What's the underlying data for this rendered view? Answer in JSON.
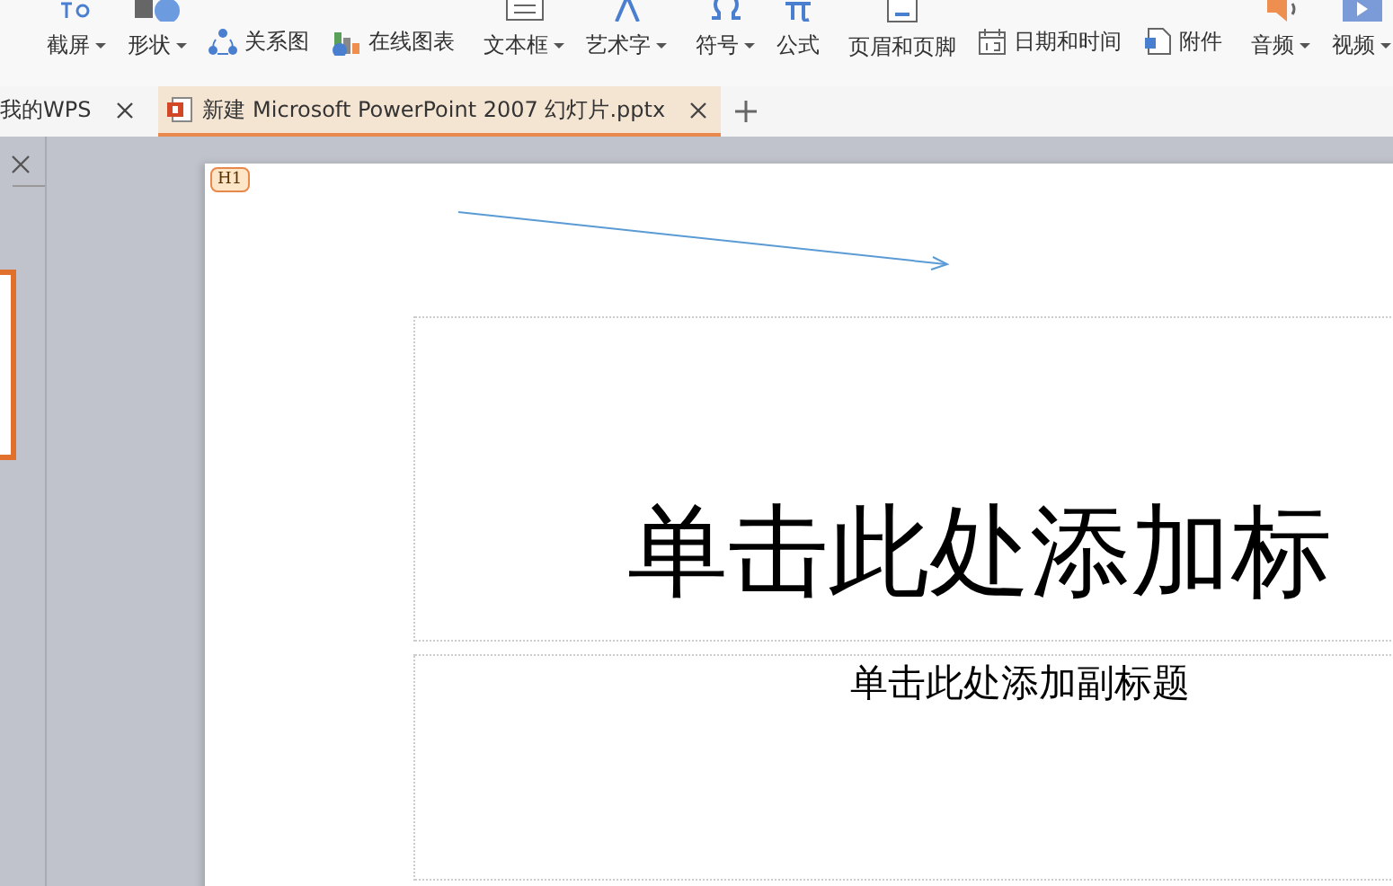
{
  "ribbon": {
    "groups": [
      {
        "items": [
          {
            "kind": "large",
            "label": "截屏",
            "dropdown": true
          },
          {
            "kind": "large",
            "label": "形状",
            "dropdown": true
          },
          {
            "kind": "small",
            "label": "关系图",
            "dropdown": false
          },
          {
            "kind": "small",
            "label": "在线图表",
            "dropdown": false
          }
        ]
      },
      {
        "items": [
          {
            "kind": "large",
            "label": "文本框",
            "dropdown": true
          },
          {
            "kind": "large",
            "label": "艺术字",
            "dropdown": true
          }
        ]
      },
      {
        "items": [
          {
            "kind": "large",
            "label": "符号",
            "dropdown": true
          },
          {
            "kind": "large",
            "label": "公式",
            "dropdown": false
          }
        ]
      },
      {
        "items": [
          {
            "kind": "large",
            "label": "页眉和页脚",
            "dropdown": false
          },
          {
            "kind": "small",
            "label": "日期和时间",
            "dropdown": false
          },
          {
            "kind": "small",
            "label": "附件",
            "dropdown": false
          }
        ]
      },
      {
        "items": [
          {
            "kind": "large",
            "label": "音频",
            "dropdown": true
          },
          {
            "kind": "large",
            "label": "视频",
            "dropdown": true
          }
        ]
      }
    ]
  },
  "tabs": [
    {
      "label": "我的WPS",
      "selected": false,
      "kind": "home"
    },
    {
      "label": "新建 Microsoft PowerPoint 2007 幻灯片.pptx",
      "selected": true,
      "kind": "document"
    }
  ],
  "slide": {
    "badge": "H1",
    "title": "单击此处添加标",
    "subtitle": "单击此处添加副标题"
  }
}
